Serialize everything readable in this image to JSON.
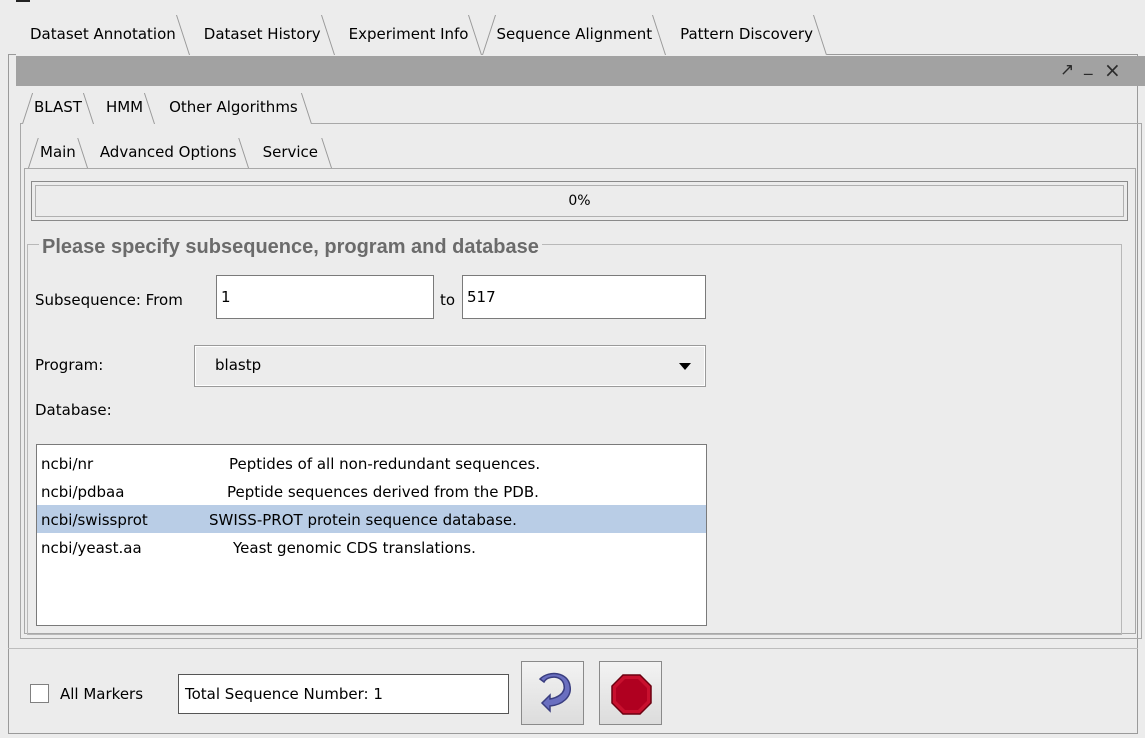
{
  "outer_tabs": [
    {
      "label": "Dataset Annotation",
      "active": false
    },
    {
      "label": "Dataset History",
      "active": false
    },
    {
      "label": "Experiment Info",
      "active": false
    },
    {
      "label": "Sequence Alignment",
      "active": true
    },
    {
      "label": "Pattern Discovery",
      "active": false
    }
  ],
  "window_controls": {
    "maximize": "↗",
    "minimize": "_",
    "close": "×"
  },
  "algorithm_tabs": [
    {
      "label": "BLAST",
      "active": true
    },
    {
      "label": "HMM",
      "active": false
    },
    {
      "label": "Other Algorithms",
      "active": false
    }
  ],
  "sub_tabs": [
    {
      "label": "Main",
      "active": true
    },
    {
      "label": "Advanced Options",
      "active": false
    },
    {
      "label": "Service",
      "active": false
    }
  ],
  "progress": {
    "value": 0,
    "text": "0%"
  },
  "options": {
    "title": "Please specify subsequence, program and database",
    "subsequence_label": "Subsequence: From",
    "from_value": "1",
    "to_label": "to",
    "to_value": "517",
    "program_label": "Program:",
    "program_value": "blastp",
    "database_label": "Database:",
    "databases": [
      {
        "name": "ncbi/nr",
        "description": "Peptides of all non-redundant sequences.",
        "selected": false
      },
      {
        "name": "ncbi/pdbaa",
        "description": "Peptide sequences  derived from the PDB.",
        "selected": false
      },
      {
        "name": "ncbi/swissprot",
        "description": "SWISS-PROT protein sequence database.",
        "selected": true
      },
      {
        "name": "ncbi/yeast.aa",
        "description": "Yeast  genomic CDS translations.",
        "selected": false
      }
    ]
  },
  "bottom": {
    "all_markers_label": "All Markers",
    "all_markers_checked": false,
    "total_sequence_text": "Total Sequence Number: 1",
    "run_icon": "refresh-arrow-icon",
    "stop_icon": "stop-octagon-icon",
    "stop_color": "#c8102e",
    "run_color": "#6a6fc0"
  },
  "colors": {
    "selected_row": "#b9cde6",
    "title_bar": "#a2a2a2",
    "group_title": "#6b6b6b"
  }
}
